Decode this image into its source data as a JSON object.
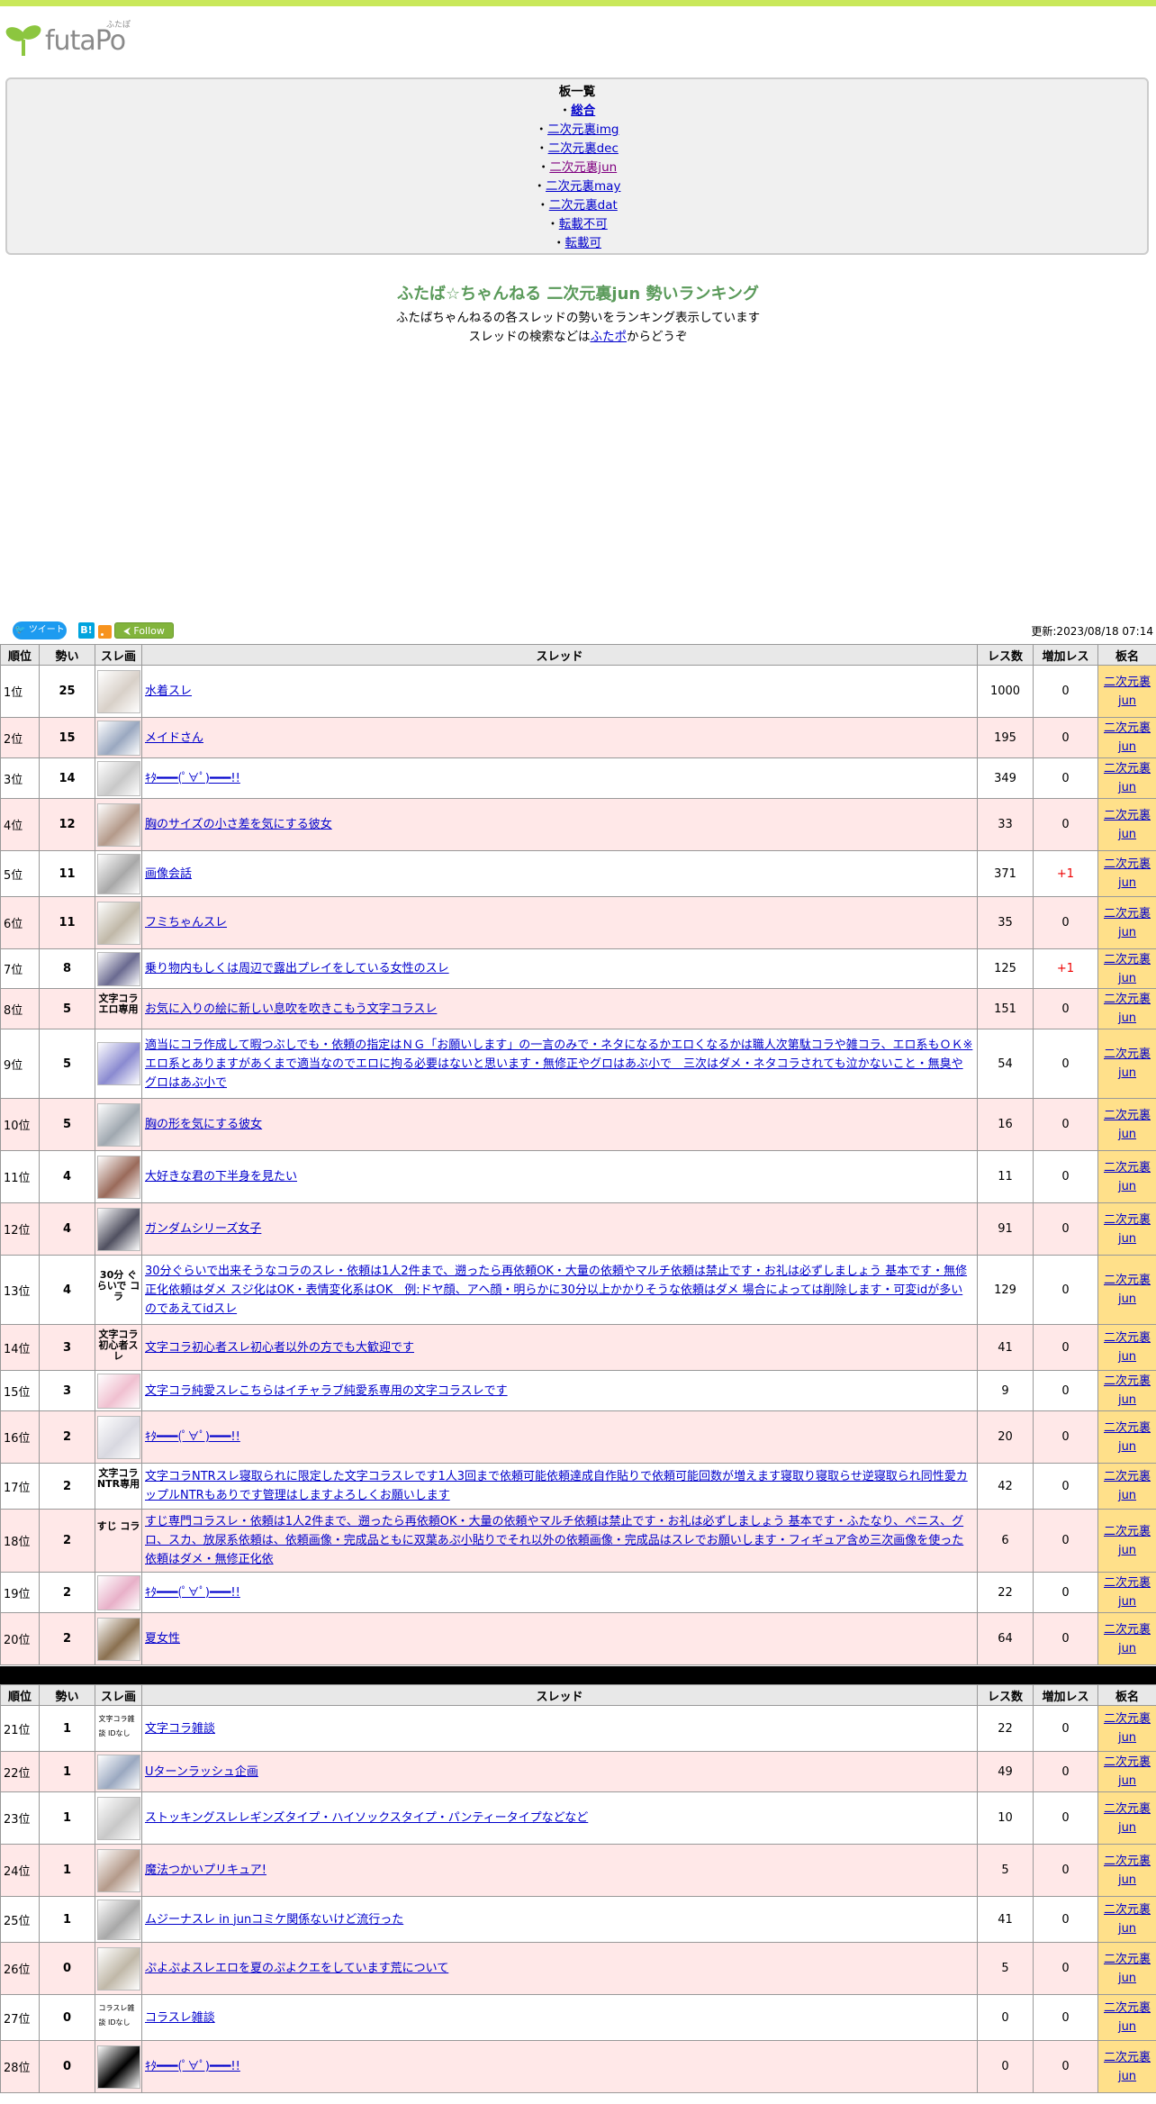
{
  "logo": {
    "wordmark": "futaPo",
    "ruby": "ふたぽ"
  },
  "boards": {
    "title": "板一覧",
    "items": [
      {
        "prefix": "・",
        "label": "総合",
        "bold": true,
        "visited": false
      },
      {
        "prefix": "・",
        "label": "二次元裏img",
        "bold": false,
        "visited": false
      },
      {
        "prefix": "・",
        "label": "二次元裏dec",
        "bold": false,
        "visited": false
      },
      {
        "prefix": "・",
        "label": "二次元裏jun",
        "bold": false,
        "visited": true
      },
      {
        "prefix": "・",
        "label": "二次元裏may",
        "bold": false,
        "visited": false
      },
      {
        "prefix": "・",
        "label": "二次元裏dat",
        "bold": false,
        "visited": false
      },
      {
        "prefix": "・",
        "label": "転載不可",
        "bold": false,
        "visited": false
      },
      {
        "prefix": "・",
        "label": "転載可",
        "bold": false,
        "visited": false
      }
    ]
  },
  "heading": "ふたば☆ちゃんねる 二次元裏jun 勢いランキング",
  "desc": {
    "line1": "ふたばちゃんねるの各スレッドの勢いをランキング表示しています",
    "line2_pre": "スレッドの検索などは",
    "line2_link": "ふたポ",
    "line2_post": "からどうぞ"
  },
  "share": {
    "tweet": "ツイート",
    "hatena": "B!",
    "follow": "Follow"
  },
  "updated": "更新:2023/08/18 07:14",
  "colors": {
    "accent_bar": "#c9e85a",
    "heading": "#5a9a5a",
    "row_alt": "#ffe8e8",
    "board_cell": "#ffe08a"
  },
  "columns": [
    "順位",
    "勢い",
    "スレ画",
    "スレッド",
    "レス数",
    "増加レス",
    "板名"
  ],
  "board_name_line1": "二次元裏",
  "board_name_line2": "jun",
  "rows_top": [
    {
      "rank": "1位",
      "ikioi": "25",
      "thumb": "image",
      "title": "水着スレ",
      "res": "1000",
      "add": "0"
    },
    {
      "rank": "2位",
      "ikioi": "15",
      "thumb": "image",
      "title": "メイドさん",
      "res": "195",
      "add": "0"
    },
    {
      "rank": "3位",
      "ikioi": "14",
      "thumb": "image",
      "title": "ｷﾀ━━━(ﾟ∀ﾟ)━━━!!",
      "res": "349",
      "add": "0"
    },
    {
      "rank": "4位",
      "ikioi": "12",
      "thumb": "image",
      "title": "胸のサイズの小さ差を気にする彼女",
      "res": "33",
      "add": "0"
    },
    {
      "rank": "5位",
      "ikioi": "11",
      "thumb": "image",
      "title": "画像会話",
      "res": "371",
      "add": "+1"
    },
    {
      "rank": "6位",
      "ikioi": "11",
      "thumb": "image",
      "title": "フミちゃんスレ",
      "res": "35",
      "add": "0"
    },
    {
      "rank": "7位",
      "ikioi": "8",
      "thumb": "image",
      "title": "乗り物内もしくは周辺で露出プレイをしている女性のスレ",
      "res": "125",
      "add": "+1"
    },
    {
      "rank": "8位",
      "ikioi": "5",
      "thumb": "text",
      "thumb_text": "文字コラ エロ専用",
      "title": "お気に入りの絵に新しい息吹を吹きこもう文字コラスレ",
      "res": "151",
      "add": "0"
    },
    {
      "rank": "9位",
      "ikioi": "5",
      "thumb": "image",
      "title": "適当にコラ作成して暇つぶしでも・依頼の指定はＮＧ「お願いします」の一言のみで・ネタになるかエロくなるかは職人次第駄コラや雑コラ、エロ系もＯＫ※エロ系とありますがあくまで適当なのでエロに拘る必要はないと思います・無修正やグロはあぶ小で　三次はダメ・ネタコラされても泣かないこと・無臭やグロはあぶ小で",
      "res": "54",
      "add": "0"
    },
    {
      "rank": "10位",
      "ikioi": "5",
      "thumb": "image",
      "title": "胸の形を気にする彼女",
      "res": "16",
      "add": "0"
    },
    {
      "rank": "11位",
      "ikioi": "4",
      "thumb": "image",
      "title": "大好きな君の下半身を見たい",
      "res": "11",
      "add": "0"
    },
    {
      "rank": "12位",
      "ikioi": "4",
      "thumb": "image",
      "title": "ガンダムシリーズ女子",
      "res": "91",
      "add": "0"
    },
    {
      "rank": "13位",
      "ikioi": "4",
      "thumb": "text",
      "thumb_text": "30分 ぐらいで コラ",
      "title": "30分ぐらいで出来そうなコラのスレ・依頼は1人2件まで、遡ったら再依頼OK・大量の依頼やマルチ依頼は禁止です・お礼は必ずしましょう 基本です・無修正化依頼はダメ スジ化はOK・表情変化系はOK　例:ドヤ顔、アヘ顔・明らかに30分以上かかりそうな依頼はダメ 場合によっては削除します・可変idが多いのであえてidスレ",
      "res": "129",
      "add": "0"
    },
    {
      "rank": "14位",
      "ikioi": "3",
      "thumb": "text",
      "thumb_text": "文字コラ 初心者スレ",
      "title": "文字コラ初心者スレ初心者以外の方でも大歓迎です",
      "res": "41",
      "add": "0"
    },
    {
      "rank": "15位",
      "ikioi": "3",
      "thumb": "image",
      "title": "文字コラ純愛スレこちらはイチャラブ純愛系専用の文字コラスレです",
      "res": "9",
      "add": "0"
    },
    {
      "rank": "16位",
      "ikioi": "2",
      "thumb": "image",
      "title": "ｷﾀ━━━(ﾟ∀ﾟ)━━━!!",
      "res": "20",
      "add": "0"
    },
    {
      "rank": "17位",
      "ikioi": "2",
      "thumb": "text",
      "thumb_text": "文字コラ NTR専用",
      "title": "文字コラNTRスレ寝取られに限定した文字コラスレです1人3回まで依頼可能依頼達成自作貼りで依頼可能回数が増えます寝取り寝取らせ逆寝取られ同性愛カップルNTRもありです管理はしますよろしくお願いします",
      "res": "42",
      "add": "0"
    },
    {
      "rank": "18位",
      "ikioi": "2",
      "thumb": "text",
      "thumb_text": "すじ コラ",
      "title": "すじ専門コラスレ・依頼は1人2件まで、遡ったら再依頼OK・大量の依頼やマルチ依頼は禁止です・お礼は必ずしましょう 基本です・ふたなり、ペニス、グロ、スカ、放尿系依頼は、依頼画像・完成品ともに双葉あぷ小貼りでそれ以外の依頼画像・完成品はスレでお願いします・フィギュア含め三次画像を使った依頼はダメ・無修正化依",
      "res": "6",
      "add": "0"
    },
    {
      "rank": "19位",
      "ikioi": "2",
      "thumb": "image",
      "title": "ｷﾀ━━━(ﾟ∀ﾟ)━━━!!",
      "res": "22",
      "add": "0"
    },
    {
      "rank": "20位",
      "ikioi": "2",
      "thumb": "image",
      "title": "夏女性",
      "res": "64",
      "add": "0"
    }
  ],
  "rows_bottom": [
    {
      "rank": "21位",
      "ikioi": "1",
      "thumb": "tiny",
      "thumb_text": "文字コラ雑談 IDなし",
      "title": "文字コラ雑談",
      "res": "22",
      "add": "0"
    },
    {
      "rank": "22位",
      "ikioi": "1",
      "thumb": "image",
      "title": "Uターンラッシュ企画",
      "res": "49",
      "add": "0"
    },
    {
      "rank": "23位",
      "ikioi": "1",
      "thumb": "image",
      "title": "ストッキングスレレギンズタイプ・ハイソックスタイプ・パンティータイプなどなど",
      "res": "10",
      "add": "0"
    },
    {
      "rank": "24位",
      "ikioi": "1",
      "thumb": "image",
      "title": "魔法つかいプリキュア!",
      "res": "5",
      "add": "0"
    },
    {
      "rank": "25位",
      "ikioi": "1",
      "thumb": "image",
      "title": "ムジーナスレ in junコミケ関係ないけど流行った",
      "res": "41",
      "add": "0"
    },
    {
      "rank": "26位",
      "ikioi": "0",
      "thumb": "image",
      "title": "ぷよぷよスレエロを夏のぷよクエをしています荒について",
      "res": "5",
      "add": "0"
    },
    {
      "rank": "27位",
      "ikioi": "0",
      "thumb": "tiny",
      "thumb_text": "コラスレ雑談 IDなし",
      "title": "コラスレ雑談",
      "res": "0",
      "add": "0"
    },
    {
      "rank": "28位",
      "ikioi": "0",
      "thumb": "image",
      "title": "ｷﾀ━━━(ﾟ∀ﾟ)━━━!!",
      "res": "0",
      "add": "0"
    }
  ]
}
